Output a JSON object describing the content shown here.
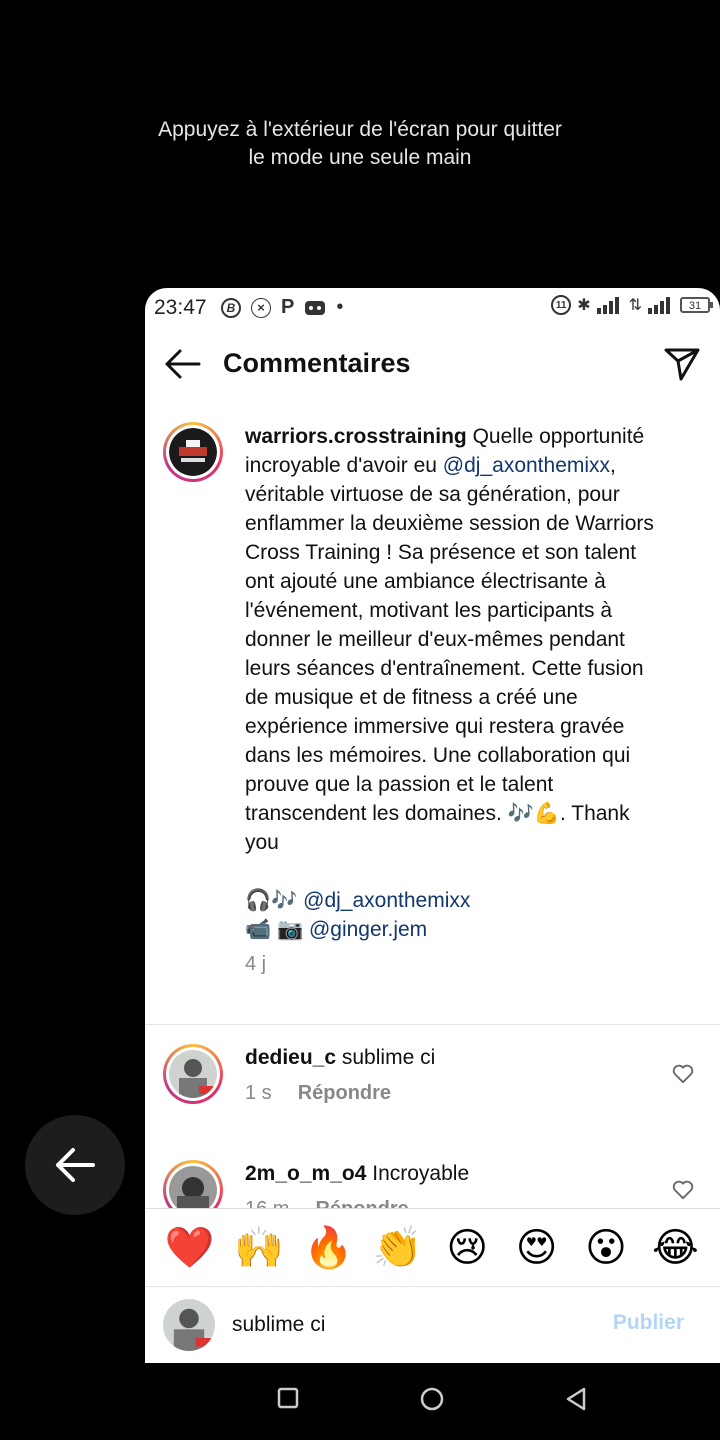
{
  "overlay_hint": {
    "line1": "Appuyez à l'extérieur de l'écran pour quitter",
    "line2": "le mode une seule main"
  },
  "status_bar": {
    "time": "23:47",
    "battery": "31"
  },
  "header": {
    "title": "Commentaires",
    "back_icon": "arrow-left-icon",
    "send_icon": "paper-plane-icon"
  },
  "post": {
    "username": "warriors.crosstraining",
    "text_part1": " Quelle opportunité incroyable d'avoir eu ",
    "mention1": "@dj_axonthemixx",
    "text_part2": ", véritable virtuose de sa génération, pour enflammer la deuxième session de Warriors Cross Training ! Sa présence et son talent ont ajouté une ambiance électrisante à l'événement, motivant les participants à donner le meilleur d'eux-mêmes pendant leurs séances d'entraînement. Cette fusion de musique et de fitness a créé une expérience immersive qui restera gravée dans les mémoires. Une collaboration qui prouve que la passion et le talent transcendent les domaines. 🎶💪. Thank you",
    "credit1_emoji": "🎧🎶 ",
    "credit1_mention": "@dj_axonthemixx",
    "credit2_emoji": "📹 📷 ",
    "credit2_mention": "@ginger.jem",
    "time": "4 j"
  },
  "comments": [
    {
      "username": "dedieu_c",
      "text": " sublime ci",
      "time": "1 s",
      "reply_label": "Répondre"
    },
    {
      "username": "2m_o_m_o4",
      "text": " Incroyable",
      "time": "16 m",
      "reply_label": "Répondre"
    }
  ],
  "emoji_bar": [
    "❤️",
    "🙌",
    "🔥",
    "👏",
    "😢",
    "😍",
    "😮",
    "😂"
  ],
  "composer": {
    "value": "sublime ci",
    "publish_label": "Publier"
  },
  "colors": {
    "mention": "#12366e",
    "publish_disabled": "#b3d6f5",
    "meta_gray": "#888888"
  }
}
